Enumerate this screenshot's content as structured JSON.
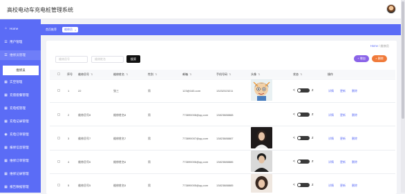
{
  "app": {
    "title": "高校电动车充电桩管理系统"
  },
  "sidebar": {
    "items": [
      {
        "label": "Home",
        "icon": "home-icon"
      },
      {
        "label": "用户管理",
        "icon": "list-icon"
      },
      {
        "label": "维修员管理",
        "icon": "list-icon"
      },
      {
        "label": "实空管理",
        "icon": "grid-icon"
      },
      {
        "label": "充值套餐管理",
        "icon": "grid-icon"
      },
      {
        "label": "充电桩管理",
        "icon": "grid-icon"
      },
      {
        "label": "充电记录管理",
        "icon": "grid-icon"
      },
      {
        "label": "充电订单管理",
        "icon": "grid-icon"
      },
      {
        "label": "报修信息管理",
        "icon": "grid-icon"
      },
      {
        "label": "维修订单管理",
        "icon": "grid-icon"
      },
      {
        "label": "维修记录管理",
        "icon": "grid-icon"
      },
      {
        "label": "报告数据管理",
        "icon": "grid-icon"
      }
    ],
    "sub_item": "维修员"
  },
  "tabs": [
    {
      "label": "首页推荐"
    },
    {
      "label": "维修员"
    }
  ],
  "breadcrumb": {
    "home": "Home",
    "sep": "/",
    "current": "维修员"
  },
  "search": {
    "field1_placeholder": "维修员号",
    "field2_placeholder": "维修姓名",
    "button": "搜索"
  },
  "actions": {
    "add": "+ 增加",
    "delete": "× 删除"
  },
  "table": {
    "headers": [
      "序号",
      "维修员号",
      "维修姓名",
      "性别",
      "邮箱",
      "手机号码",
      "头像",
      "状态",
      "操作"
    ],
    "rows": [
      {
        "index": "1",
        "id": "22",
        "name": "张三",
        "gender": "男",
        "email": "123@163.com",
        "phone": "13232323211",
        "avatar": "cartoon"
      },
      {
        "index": "2",
        "id": "维修员号8",
        "name": "维修姓名8",
        "gender": "男",
        "email": "773890008@qq.com",
        "phone": "13823888888",
        "avatar": ""
      },
      {
        "index": "3",
        "id": "维修员号7",
        "name": "维修姓名7",
        "gender": "男",
        "email": "773890007@qq.com",
        "phone": "13823888887",
        "avatar": "woman-dark"
      },
      {
        "index": "4",
        "id": "维修员号6",
        "name": "维修姓名6",
        "gender": "男",
        "email": "773890006@qq.com",
        "phone": "13823888886",
        "avatar": "man-dark"
      },
      {
        "index": "5",
        "id": "维修员号5",
        "name": "维修姓名5",
        "gender": "男",
        "email": "773890005@qq.com",
        "phone": "13823888885",
        "avatar": "woman-curly"
      }
    ],
    "row_actions": [
      "详情",
      "更新",
      "删除"
    ]
  },
  "colors": {
    "accent": "#5b6cf6",
    "add": "#8a63e8",
    "delete": "#f07a3a"
  }
}
